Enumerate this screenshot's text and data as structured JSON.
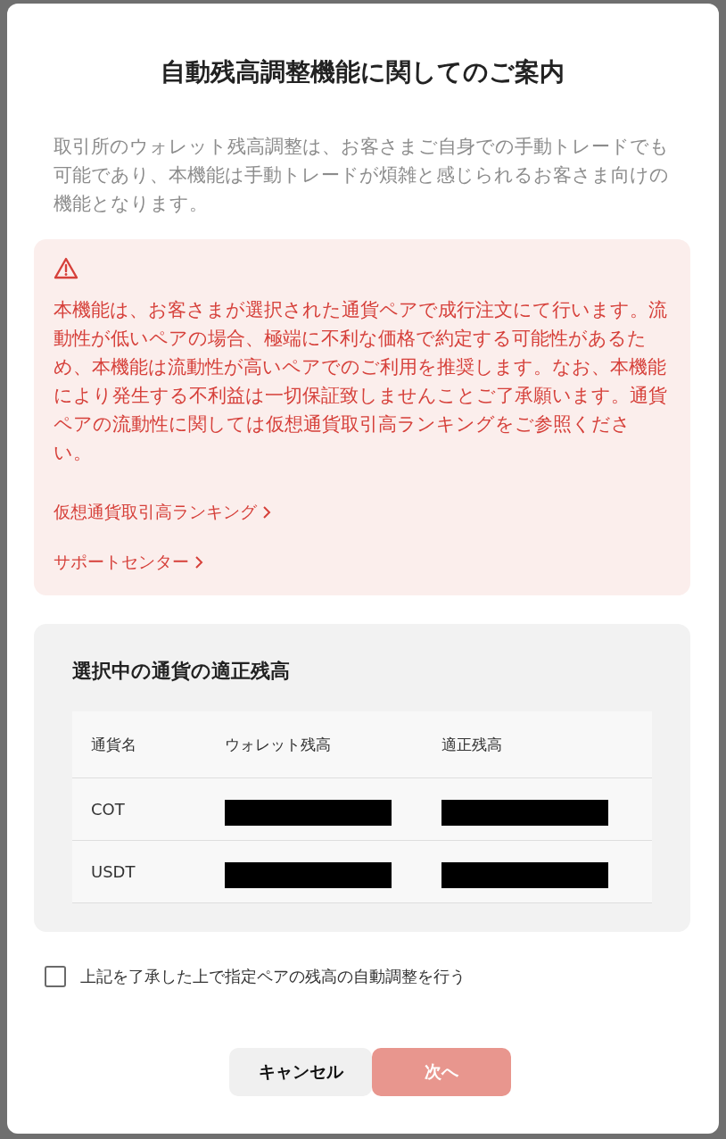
{
  "dialog": {
    "title": "自動残高調整機能に関してのご案内",
    "intro": "取引所のウォレット残高調整は、お客さまご自身での手動トレードでも可能であり、本機能は手動トレードが煩雑と感じられるお客さま向けの機能となります。",
    "warning": {
      "text": "本機能は、お客さまが選択された通貨ペアで成行注文にて行います。流動性が低いペアの場合、極端に不利な価格で約定する可能性があるため、本機能は流動性が高いペアでのご利用を推奨します。なお、本機能により発生する不利益は一切保証致しませんことご了承願います。通貨ペアの流動性に関しては仮想通貨取引高ランキングをご参照ください。",
      "links": [
        "仮想通貨取引高ランキング",
        "サポートセンター"
      ]
    },
    "balances": {
      "title": "選択中の通貨の適正残高",
      "columns": [
        "通貨名",
        "ウォレット残高",
        "適正残高"
      ],
      "rows": [
        {
          "currency": "COT",
          "cells": [
            {
              "kind": "redacted"
            },
            {
              "kind": "redacted"
            }
          ]
        },
        {
          "currency": "USDT",
          "cells": [
            {
              "kind": "redacted"
            },
            {
              "kind": "redacted"
            }
          ]
        }
      ]
    },
    "agreement": {
      "label": "上記を了承した上で指定ペアの残高の自動調整を行う",
      "checked": false
    },
    "buttons": [
      {
        "label": "キャンセル",
        "kind": "secondary",
        "disabled": false
      },
      {
        "label": "次へ",
        "kind": "primary",
        "disabled": true
      }
    ]
  }
}
